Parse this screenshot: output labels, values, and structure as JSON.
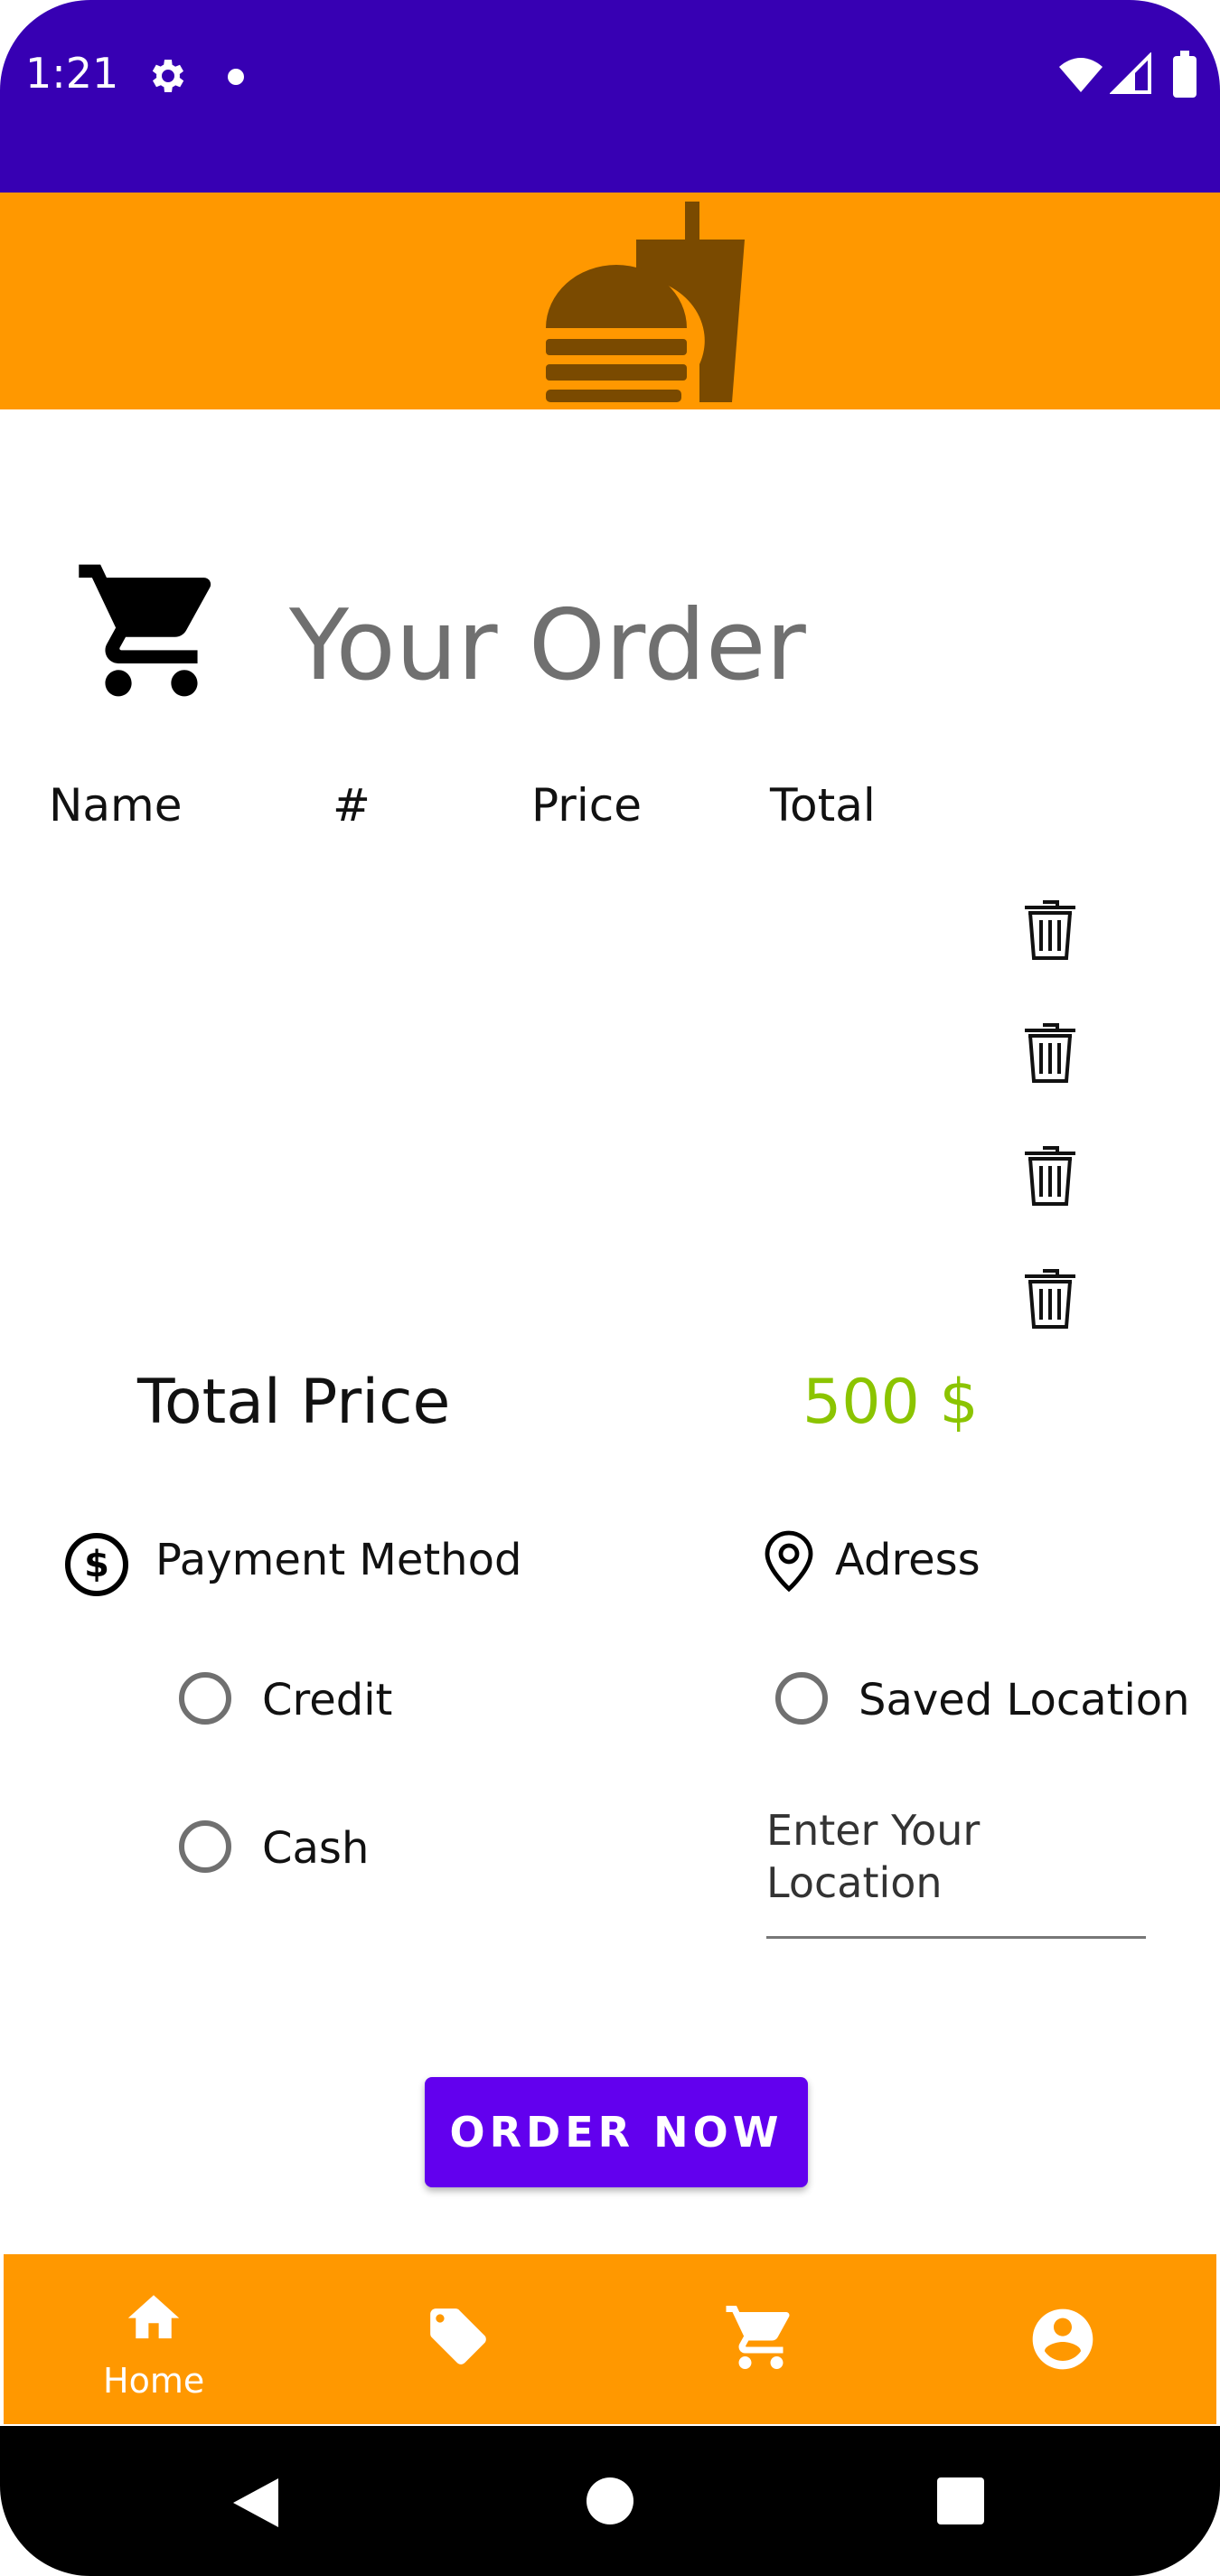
{
  "status_bar": {
    "time": "1:21"
  },
  "order": {
    "title": "Your Order",
    "columns": {
      "name": "Name",
      "qty": "#",
      "price": "Price",
      "total": "Total"
    },
    "total_label": "Total Price",
    "total_value": "500 $"
  },
  "payment": {
    "label": "Payment Method",
    "options": [
      "Credit",
      "Cash"
    ]
  },
  "address": {
    "label": "Adress",
    "saved_option": "Saved Location",
    "input_placeholder": "Enter Your Location"
  },
  "order_button": {
    "label": "ORDER NOW"
  },
  "bottom_nav": {
    "home_label": "Home"
  },
  "colors": {
    "status_bar": "#3700b3",
    "header": "#ff9800",
    "logo": "#7a4a00",
    "total_price": "#8bc400",
    "button": "#6200ee"
  }
}
